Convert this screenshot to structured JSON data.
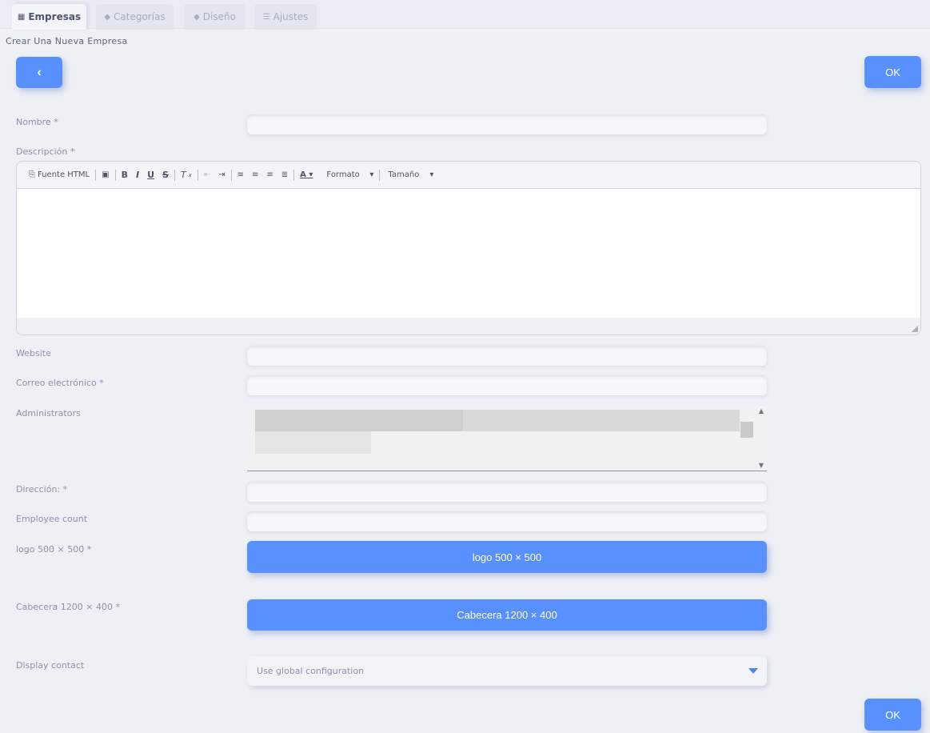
{
  "tabs": [
    {
      "label": "Empresas",
      "icon": "building-icon",
      "active": true
    },
    {
      "label": "Categorías",
      "icon": "tag-icon",
      "active": false
    },
    {
      "label": "Diseño",
      "icon": "tag-icon",
      "active": false
    },
    {
      "label": "Ajustes",
      "icon": "sliders-icon",
      "active": false
    }
  ],
  "page_title": "Crear Una Nueva Empresa",
  "buttons": {
    "back": "‹",
    "ok": "OK",
    "ok_bottom": "OK"
  },
  "fields": {
    "nombre": "Nombre *",
    "descripcion": "Descripción *",
    "website": "Website",
    "correo": "Correo electrónico *",
    "administrators": "Administrators",
    "direccion": "Dirección: *",
    "employee_count": "Employee count",
    "logo": "logo 500 × 500 *",
    "cabecera": "Cabecera 1200 × 400 *",
    "display_contact": "Display contact"
  },
  "upload": {
    "logo": "logo 500 × 500",
    "cabecera": "Cabecera 1200 × 400"
  },
  "editor": {
    "source": "Fuente HTML",
    "formato": "Formato",
    "tamano": "Tamaño"
  },
  "display_contact": {
    "selected": "Use global configuration"
  },
  "colors": {
    "accent": "#5890ff",
    "background": "#eef0f6"
  }
}
